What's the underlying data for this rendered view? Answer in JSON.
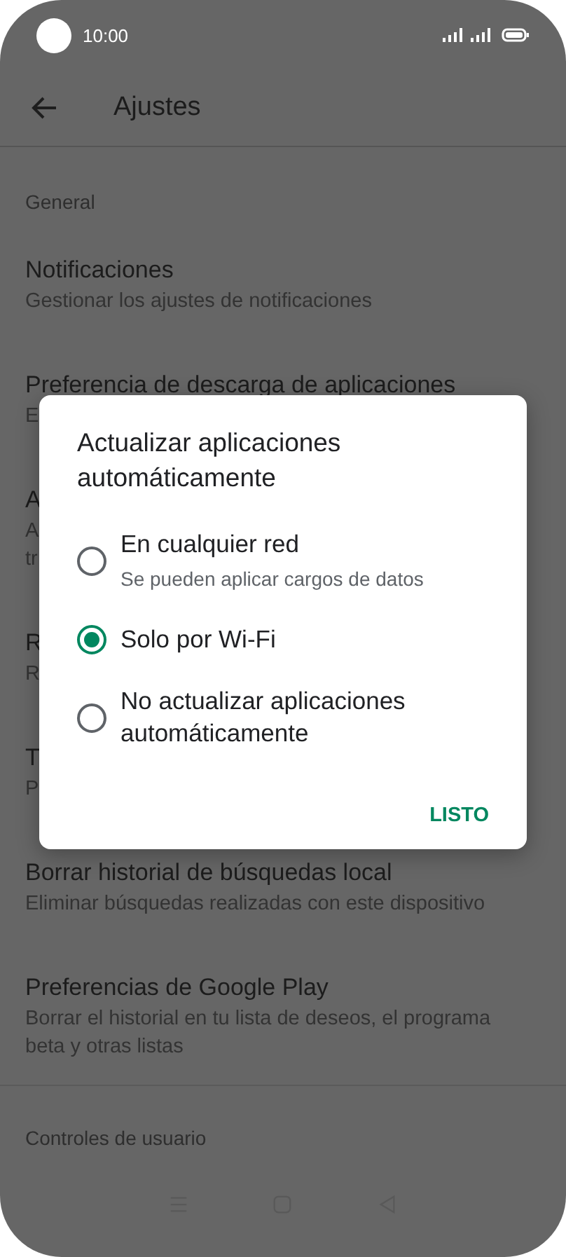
{
  "status_bar": {
    "time": "10:00"
  },
  "app_bar": {
    "title": "Ajustes"
  },
  "sections": [
    {
      "header": "General",
      "items": [
        {
          "title": "Notificaciones",
          "subtitle": [
            "Gestionar los ajustes de notificaciones"
          ]
        },
        {
          "title": "Preferencia de descarga de aplicaciones",
          "subtitle": [
            "E"
          ]
        },
        {
          "title": "A",
          "subtitle": [
            "A",
            "tr"
          ]
        },
        {
          "title": "R",
          "subtitle": [
            "R"
          ]
        },
        {
          "title": "T",
          "subtitle": [
            "P"
          ]
        },
        {
          "title": "Borrar historial de búsquedas local",
          "subtitle": [
            "Eliminar búsquedas realizadas con este dispositivo"
          ]
        },
        {
          "title": "Preferencias de Google Play",
          "subtitle": [
            "Borrar el historial en tu lista de deseos, el programa",
            "beta y otras listas"
          ]
        }
      ]
    },
    {
      "header": "Controles de usuario"
    }
  ],
  "dialog": {
    "title": "Actualizar aplicaciones automáticamente",
    "options": [
      {
        "label": "En cualquier red",
        "sublabel": "Se pueden aplicar cargos de datos",
        "selected": false
      },
      {
        "label": "Solo por Wi-Fi",
        "selected": true
      },
      {
        "label": "No actualizar aplicaciones automáticamente",
        "selected": false
      }
    ],
    "button": "LISTO"
  }
}
